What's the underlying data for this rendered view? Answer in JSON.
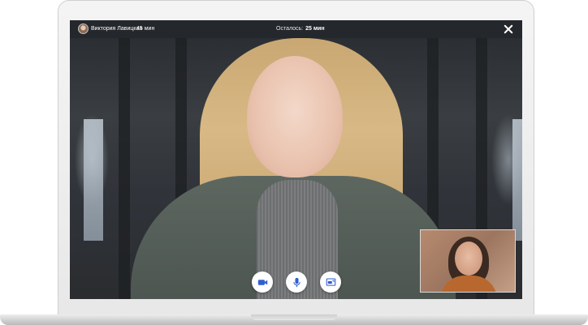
{
  "call": {
    "user_name": "Виктория Лавицкая",
    "user_duration": "45 мин",
    "remaining_label": "Осталось:",
    "remaining_value": "25 мин"
  },
  "controls": [
    {
      "name": "camera-button",
      "icon": "video-camera-icon"
    },
    {
      "name": "microphone-button",
      "icon": "microphone-icon"
    },
    {
      "name": "screen-share-button",
      "icon": "screen-share-icon"
    }
  ],
  "colors": {
    "accent": "#2f5fd0",
    "topbar_bg": "#24272b",
    "button_bg": "#ffffff"
  }
}
